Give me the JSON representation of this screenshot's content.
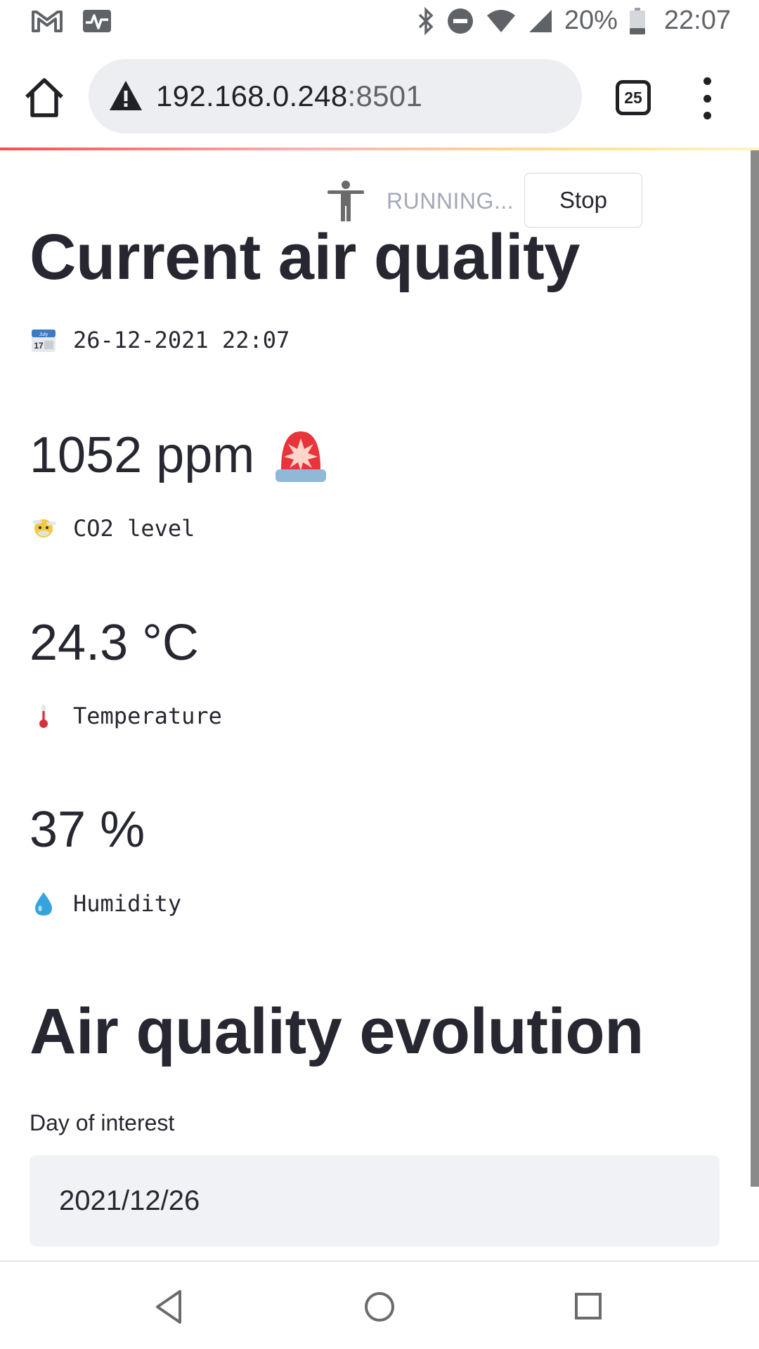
{
  "status_bar": {
    "battery_percent": "20%",
    "clock": "22:07",
    "left_icons": [
      "gmail-icon",
      "activity-icon"
    ],
    "right_icons": [
      "bluetooth-icon",
      "do-not-disturb-icon",
      "wifi-icon",
      "cellular-icon",
      "battery-icon"
    ]
  },
  "browser": {
    "url_host": "192.168.0.248",
    "url_port": ":8501",
    "tab_count": "25"
  },
  "app": {
    "running_label": "RUNNING...",
    "stop_label": "Stop",
    "title": "Current air quality",
    "timestamp": "26-12-2021 22:07",
    "metrics": [
      {
        "value": "1052 ppm",
        "label": "CO2 level",
        "icon": "fog-face-icon",
        "alert_icon": "siren-icon"
      },
      {
        "value": "24.3 °C",
        "label": "Temperature",
        "icon": "thermometer-icon"
      },
      {
        "value": "37 %",
        "label": "Humidity",
        "icon": "droplet-icon"
      }
    ],
    "evolution_title": "Air quality evolution",
    "day_label": "Day of interest",
    "day_value": "2021/12/26"
  },
  "colors": {
    "text": "#262730",
    "running_text": "#a3a8b8",
    "input_bg": "#f0f2f6",
    "accent_red": "#ff4b4b"
  }
}
